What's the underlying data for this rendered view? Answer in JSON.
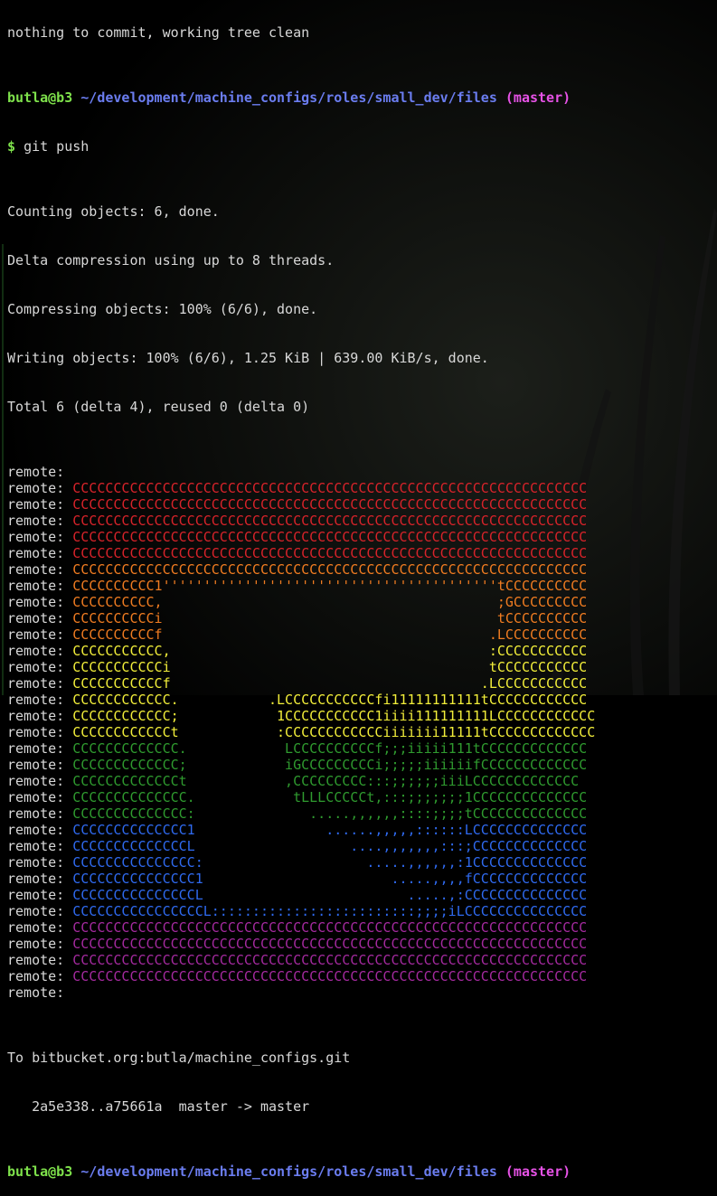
{
  "prompt": {
    "user_host": "butla@b3",
    "path": "~/development/machine_configs/roles/small_dev/files",
    "branch": "(master)",
    "symbol": "$"
  },
  "lines": {
    "partial_top": "nothing to commit, working tree clean",
    "command": "git push",
    "counting": "Counting objects: 6, done.",
    "delta": "Delta compression using up to 8 threads.",
    "compressing": "Compressing objects: 100% (6/6), done.",
    "writing": "Writing objects: 100% (6/6), 1.25 KiB | 639.00 KiB/s, done.",
    "total": "Total 6 (delta 4), reused 0 (delta 0)",
    "remote_prefix": "remote: ",
    "to": "To bitbucket.org:butla/machine_configs.git",
    "ref_update": "   2a5e338..a75661a  master -> master"
  },
  "remote_art": [
    {
      "text": "",
      "color": "#d8232a"
    },
    {
      "text": "CCCCCCCCCCCCCCCCCCCCCCCCCCCCCCCCCCCCCCCCCCCCCCCCCCCCCCCCCCCCCCC",
      "color": "#d8232a"
    },
    {
      "text": "CCCCCCCCCCCCCCCCCCCCCCCCCCCCCCCCCCCCCCCCCCCCCCCCCCCCCCCCCCCCCCC",
      "color": "#d8232a"
    },
    {
      "text": "CCCCCCCCCCCCCCCCCCCCCCCCCCCCCCCCCCCCCCCCCCCCCCCCCCCCCCCCCCCCCCC",
      "color": "#d8232a"
    },
    {
      "text": "CCCCCCCCCCCCCCCCCCCCCCCCCCCCCCCCCCCCCCCCCCCCCCCCCCCCCCCCCCCCCCC",
      "color": "#d8232a"
    },
    {
      "text": "CCCCCCCCCCCCCCCCCCCCCCCCCCCCCCCCCCCCCCCCCCCCCCCCCCCCCCCCCCCCCCC",
      "color": "#d8232a"
    },
    {
      "text": "CCCCCCCCCCCCCCCCCCCCCCCCCCCCCCCCCCCCCCCCCCCCCCCCCCCCCCCCCCCCCCC",
      "color": "#f07c21"
    },
    {
      "text": "CCCCCCCCCC1'''''''''''''''''''''''''''''''''''''''''tCCCCCCCCCC",
      "color": "#f07c21"
    },
    {
      "text": "CCCCCCCCCC,                                         ;GCCCCCCCCC",
      "color": "#f07c21"
    },
    {
      "text": "CCCCCCCCCCi                                         tCCCCCCCCCC",
      "color": "#f07c21"
    },
    {
      "text": "CCCCCCCCCCf                                        .LCCCCCCCCCC",
      "color": "#f07c21"
    },
    {
      "text": "CCCCCCCCCCC,                                       :CCCCCCCCCCC",
      "color": "#f2ee3a"
    },
    {
      "text": "CCCCCCCCCCCi                                       tCCCCCCCCCCC",
      "color": "#f2ee3a"
    },
    {
      "text": "CCCCCCCCCCCf                                      .LCCCCCCCCCCC",
      "color": "#f2ee3a"
    },
    {
      "text": "CCCCCCCCCCCC.           .LCCCCCCCCCCCfi11111111111tCCCCCCCCCCCC",
      "color": "#f2ee3a"
    },
    {
      "text": "CCCCCCCCCCCC;            1CCCCCCCCCCC1iiii111111111LCCCCCCCCCCCC",
      "color": "#f2ee3a"
    },
    {
      "text": "CCCCCCCCCCCCt            :CCCCCCCCCCCCiiiiiii11111tCCCCCCCCCCCCC",
      "color": "#f2ee3a"
    },
    {
      "text": "CCCCCCCCCCCCC.            LCCCCCCCCCCf;;;iiiii111tCCCCCCCCCCCCC",
      "color": "#2f9b2f"
    },
    {
      "text": "CCCCCCCCCCCCC;            iGCCCCCCCCCi;;;;;iiiiiifCCCCCCCCCCCCC",
      "color": "#2f9b2f"
    },
    {
      "text": "CCCCCCCCCCCCCt            ,CCCCCCCCC:::;;;;;;iiiLCCCCCCCCCCCCC",
      "color": "#2f9b2f"
    },
    {
      "text": "CCCCCCCCCCCCCC.            tLLLCCCCCt,:::;;;;;;;1CCCCCCCCCCCCCC",
      "color": "#2f9b2f"
    },
    {
      "text": "CCCCCCCCCCCCCC:              .....,,,,,,::::;;;;tCCCCCCCCCCCCCC",
      "color": "#2f9b2f"
    },
    {
      "text": "CCCCCCCCCCCCCC1                ......,,,,,::::::LCCCCCCCCCCCCCC",
      "color": "#2f6af0"
    },
    {
      "text": "CCCCCCCCCCCCCCL                   ....,,,,,,,:::;CCCCCCCCCCCCCC",
      "color": "#2f6af0"
    },
    {
      "text": "CCCCCCCCCCCCCCC:                    .....,,,,,,:1CCCCCCCCCCCCCC",
      "color": "#2f6af0"
    },
    {
      "text": "CCCCCCCCCCCCCCC1                       .....,,,,fCCCCCCCCCCCCCC",
      "color": "#2f6af0"
    },
    {
      "text": "CCCCCCCCCCCCCCCL                         .....,:CCCCCCCCCCCCCCC",
      "color": "#2f6af0"
    },
    {
      "text": "CCCCCCCCCCCCCCCCL:::::::::::::::::::::::::;;;;iLCCCCCCCCCCCCCCC",
      "color": "#2f6af0"
    },
    {
      "text": "CCCCCCCCCCCCCCCCCCCCCCCCCCCCCCCCCCCCCCCCCCCCCCCCCCCCCCCCCCCCCCC",
      "color": "#a42a9f"
    },
    {
      "text": "CCCCCCCCCCCCCCCCCCCCCCCCCCCCCCCCCCCCCCCCCCCCCCCCCCCCCCCCCCCCCCC",
      "color": "#a42a9f"
    },
    {
      "text": "CCCCCCCCCCCCCCCCCCCCCCCCCCCCCCCCCCCCCCCCCCCCCCCCCCCCCCCCCCCCCCC",
      "color": "#a42a9f"
    },
    {
      "text": "CCCCCCCCCCCCCCCCCCCCCCCCCCCCCCCCCCCCCCCCCCCCCCCCCCCCCCCCCCCCCCC",
      "color": "#a42a9f"
    },
    {
      "text": "",
      "color": "#a42a9f"
    }
  ]
}
